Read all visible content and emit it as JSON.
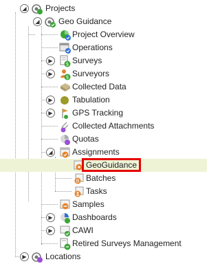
{
  "tree": {
    "root": {
      "label": "Projects",
      "icon": "projects-folder-icon"
    },
    "project": {
      "label": "Geo Guidance",
      "icon": "project-check-icon"
    },
    "items": [
      {
        "key": "project_overview",
        "label": "Project Overview",
        "icon": "pie-overview-icon",
        "badge": "check"
      },
      {
        "key": "operations",
        "label": "Operations",
        "icon": "operations-window-icon",
        "badge": "check"
      },
      {
        "key": "surveys",
        "label": "Surveys",
        "icon": "survey-document-icon",
        "badge": "dollar"
      },
      {
        "key": "surveyors",
        "label": "Surveyors",
        "icon": "surveyor-person-icon",
        "badge": "dollar"
      },
      {
        "key": "collected_data",
        "label": "Collected Data",
        "icon": "database-icon"
      },
      {
        "key": "tabulation",
        "label": "Tabulation",
        "icon": "tabulation-dot-icon"
      },
      {
        "key": "gps_tracking",
        "label": "GPS Tracking",
        "icon": "gps-pin-icon"
      },
      {
        "key": "collected_attachments",
        "label": "Collected Attachments",
        "icon": "paperclip-icon"
      },
      {
        "key": "quotas",
        "label": "Quotas",
        "icon": "quota-pie-icon"
      },
      {
        "key": "assignments",
        "label": "Assignments",
        "icon": "assignments-calendar-icon"
      },
      {
        "key": "geoguidance",
        "label": "GeoGuidance",
        "icon": "geoguidance-icon"
      },
      {
        "key": "batches",
        "label": "Batches",
        "icon": "batches-icon"
      },
      {
        "key": "tasks",
        "label": "Tasks",
        "icon": "tasks-icon"
      },
      {
        "key": "samples",
        "label": "Samples",
        "icon": "samples-icon"
      },
      {
        "key": "dashboards",
        "label": "Dashboards",
        "icon": "dashboard-icon"
      },
      {
        "key": "cawi",
        "label": "CAWI",
        "icon": "cawi-icon"
      },
      {
        "key": "retired_surveys",
        "label": "Retired Surveys Management",
        "icon": "retired-surveys-icon"
      }
    ],
    "locations": {
      "label": "Locations",
      "icon": "locations-icon"
    }
  },
  "colors": {
    "selection_row": "#eef3d6",
    "highlight_outline": "#e60000",
    "green": "#3aa635",
    "orange": "#e8822a",
    "blue": "#2f6fd6",
    "purple": "#9b4fd6"
  }
}
